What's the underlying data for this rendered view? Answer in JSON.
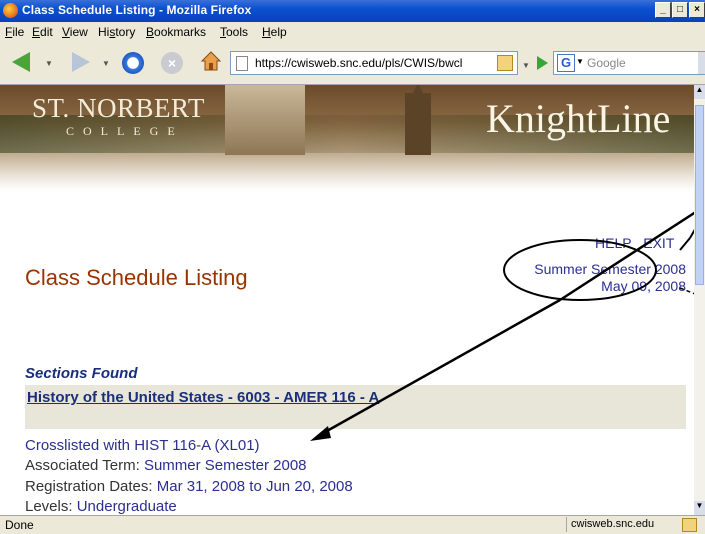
{
  "window": {
    "title": "Class Schedule Listing - Mozilla Firefox"
  },
  "menu": [
    {
      "label": "File",
      "accel": "F",
      "rest": "ile"
    },
    {
      "label": "Edit",
      "accel": "E",
      "rest": "dit"
    },
    {
      "label": "View",
      "accel": "V",
      "rest": "iew"
    },
    {
      "label": "History",
      "accel": "s",
      "pre": "Hi",
      "rest": "tory"
    },
    {
      "label": "Bookmarks",
      "accel": "B",
      "rest": "ookmarks"
    },
    {
      "label": "Tools",
      "accel": "T",
      "rest": "ools"
    },
    {
      "label": "Help",
      "accel": "H",
      "rest": "elp"
    }
  ],
  "toolbar": {
    "url": "https://cwisweb.snc.edu/pls/CWIS/bwcl",
    "search_placeholder": "Google"
  },
  "banner": {
    "college_name": "ST. NORBERT",
    "college_word": "COLLEGE",
    "portal": "KnightLine"
  },
  "page": {
    "help": "HELP",
    "exit": "EXIT",
    "title": "Class Schedule Listing",
    "term": "Summer Semester 2008",
    "date": "May 09, 2008",
    "sections_found": "Sections Found",
    "section_title": "History of the United States - 6003 - AMER 116 - A",
    "crosslisted": "Crosslisted with HIST 116-A (XL01)",
    "assoc_label": "Associated Term:",
    "assoc_value": "Summer Semester 2008",
    "reg_label": "Registration Dates:",
    "reg_value": "Mar 31, 2008 to Jun 20, 2008",
    "levels_label": "Levels:",
    "levels_value": "Undergraduate"
  },
  "status": {
    "text": "Done",
    "domain": "cwisweb.snc.edu"
  }
}
